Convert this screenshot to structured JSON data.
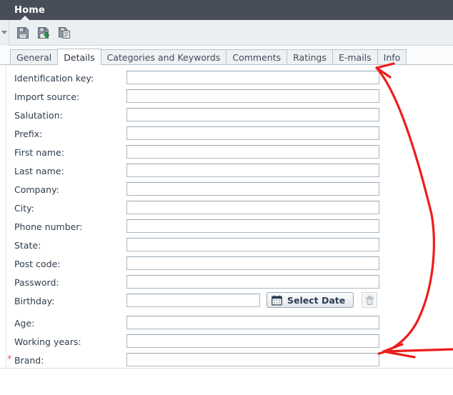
{
  "window": {
    "title": "Home",
    "header_color": "#474e58"
  },
  "toolbar": {
    "overflow_label": "",
    "buttons": [
      {
        "name": "save-button",
        "icon": "floppy-disk-icon",
        "tooltip": "Save"
      },
      {
        "name": "save-and-close-button",
        "icon": "floppy-disk-download-icon",
        "tooltip": "Save and Close"
      },
      {
        "name": "copy-button",
        "icon": "copy-document-icon",
        "tooltip": "Copy"
      }
    ]
  },
  "tabs": [
    {
      "label": "General",
      "active": false
    },
    {
      "label": "Details",
      "active": true
    },
    {
      "label": "Categories and Keywords",
      "active": false
    },
    {
      "label": "Comments",
      "active": false
    },
    {
      "label": "Ratings",
      "active": false
    },
    {
      "label": "E-mails",
      "active": false
    },
    {
      "label": "Info",
      "active": false
    }
  ],
  "form": {
    "required_marker": "*",
    "rows": [
      {
        "label": "Identification key:",
        "value": "",
        "required": false,
        "type": "text"
      },
      {
        "label": "Import source:",
        "value": "",
        "required": false,
        "type": "text"
      },
      {
        "label": "Salutation:",
        "value": "",
        "required": false,
        "type": "text"
      },
      {
        "label": "Prefix:",
        "value": "",
        "required": false,
        "type": "text"
      },
      {
        "label": "First name:",
        "value": "",
        "required": false,
        "type": "text"
      },
      {
        "label": "Last name:",
        "value": "",
        "required": false,
        "type": "text"
      },
      {
        "label": "Company:",
        "value": "",
        "required": false,
        "type": "text"
      },
      {
        "label": "City:",
        "value": "",
        "required": false,
        "type": "text"
      },
      {
        "label": "Phone number:",
        "value": "",
        "required": false,
        "type": "text"
      },
      {
        "label": "State:",
        "value": "",
        "required": false,
        "type": "text"
      },
      {
        "label": "Post code:",
        "value": "",
        "required": false,
        "type": "text"
      },
      {
        "label": "Password:",
        "value": "",
        "required": false,
        "type": "text"
      },
      {
        "label": "Birthday:",
        "value": "",
        "required": false,
        "type": "date"
      },
      {
        "label": "Age:",
        "value": "",
        "required": false,
        "type": "text"
      },
      {
        "label": "Working years:",
        "value": "",
        "required": false,
        "type": "text"
      },
      {
        "label": "Brand:",
        "value": "",
        "required": true,
        "type": "text"
      }
    ],
    "date_button": {
      "label": "Select Date",
      "icon": "calendar-icon"
    },
    "clear_button": {
      "icon": "trash-icon"
    }
  },
  "annotations": {
    "color": "#ee1c1c",
    "items": [
      {
        "name": "arrow-to-tabstrip",
        "direction": "up-left"
      },
      {
        "name": "arrow-to-brand-field",
        "direction": "left"
      }
    ]
  }
}
